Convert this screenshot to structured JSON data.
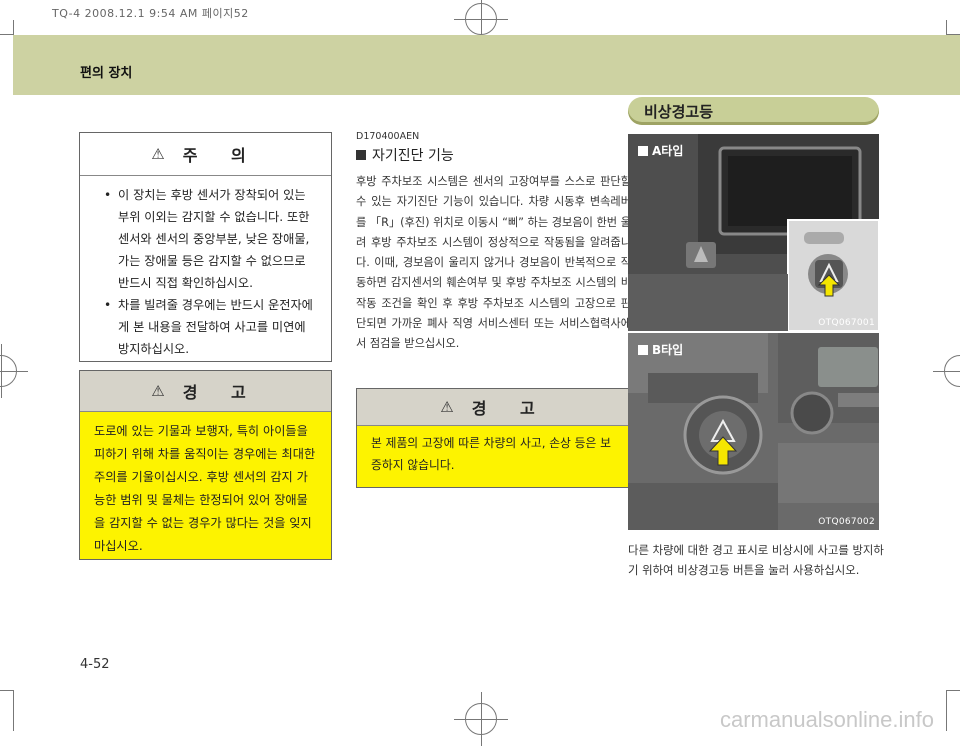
{
  "print_info": "TQ-4  2008.12.1 9:54 AM  페이지52",
  "section_title": "편의 장치",
  "caution": {
    "title": "주 의",
    "items": [
      "이 장치는 후방 센서가 장착되어 있는 부위 이외는 감지할 수 없습니다. 또한 센서와 센서의 중앙부분, 낮은 장애물, 가는 장애물 등은 감지할 수 없으므로 반드시 직접 확인하십시오.",
      "차를 빌려줄 경우에는 반드시 운전자에게 본 내용을 전달하여 사고를 미연에 방지하십시오."
    ]
  },
  "warning1": {
    "title": "경 고",
    "body": "도로에 있는 기물과 보행자, 특히 아이들을 피하기 위해 차를 움직이는 경우에는 최대한 주의를 기울이십시오. 후방 센서의 감지 가능한 범위 및 물체는 한정되어 있어 장애물을 감지할 수 없는 경우가 많다는 것을 잊지 마십시오."
  },
  "self_diag": {
    "code": "D170400AEN",
    "heading": "자기진단 기능",
    "paragraph": "후방 주차보조 시스템은 센서의 고장여부를 스스로 판단할 수 있는 자기진단 기능이 있습니다. 차량 시동후 변속레버를 「R」(후진) 위치로 이동시 “삐” 하는 경보음이 한번 울려 후방 주차보조 시스템이 정상적으로 작동됨을 알려줍니다. 이때, 경보음이 울리지 않거나 경보음이 반복적으로 작동하면 감지센서의 훼손여부 및 후방 주차보조 시스템의 비작동 조건을 확인 후 후방 주차보조 시스템의 고장으로 판단되면 가까운 폐사 직영 서비스센터 또는 서비스협력사에서 점검을 받으십시오."
  },
  "warning2": {
    "title": "경 고",
    "body": "본 제품의 고장에 따른 차량의 사고, 손상 등은 보증하지 않습니다."
  },
  "hazard": {
    "banner": "비상경고등",
    "type_a": "A타입",
    "type_a_code": "OTQ067001",
    "type_b": "B타입",
    "type_b_code": "OTQ067002",
    "caption": "다른 차량에 대한 경고 표시로 비상시에 사고를 방지하기 위하여 비상경고등 버튼을 눌러 사용하십시오."
  },
  "page_number": "4-52",
  "watermark": "carmanualsonline.info",
  "colors": {
    "header_band": "#cdd2a2",
    "warning_yellow": "#fdf300",
    "banner": "#c8cf97"
  }
}
